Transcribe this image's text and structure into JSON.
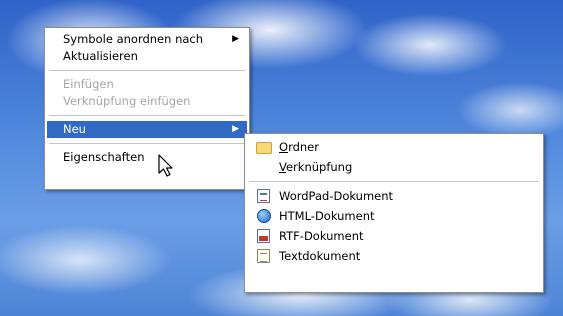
{
  "context_menu": {
    "items": [
      {
        "label": "Symbole anordnen nach",
        "has_submenu": true,
        "state": "normal"
      },
      {
        "label": "Aktualisieren",
        "state": "normal"
      },
      {
        "label": "Einfügen",
        "state": "disabled"
      },
      {
        "label": "Verknüpfung einfügen",
        "state": "disabled"
      },
      {
        "label": "Neu",
        "has_submenu": true,
        "state": "highlighted"
      },
      {
        "label": "Eigenschaften",
        "state": "normal"
      }
    ],
    "submenu_arrow": "▶"
  },
  "submenu_new": {
    "items": [
      {
        "label_first": "O",
        "label_rest": "rdner",
        "icon": "folder-icon"
      },
      {
        "label_first": "V",
        "label_rest": "erknüpfung",
        "icon": ""
      },
      {
        "label": "WordPad-Dokument",
        "icon": "wordpad-document-icon"
      },
      {
        "label": "HTML-Dokument",
        "icon": "html-document-icon"
      },
      {
        "label": "RTF-Dokument",
        "icon": "rtf-document-icon"
      },
      {
        "label": "Textdokument",
        "icon": "text-document-icon"
      }
    ]
  },
  "colors": {
    "highlight": "#316ac5",
    "disabled_text": "#a6a6a6"
  }
}
